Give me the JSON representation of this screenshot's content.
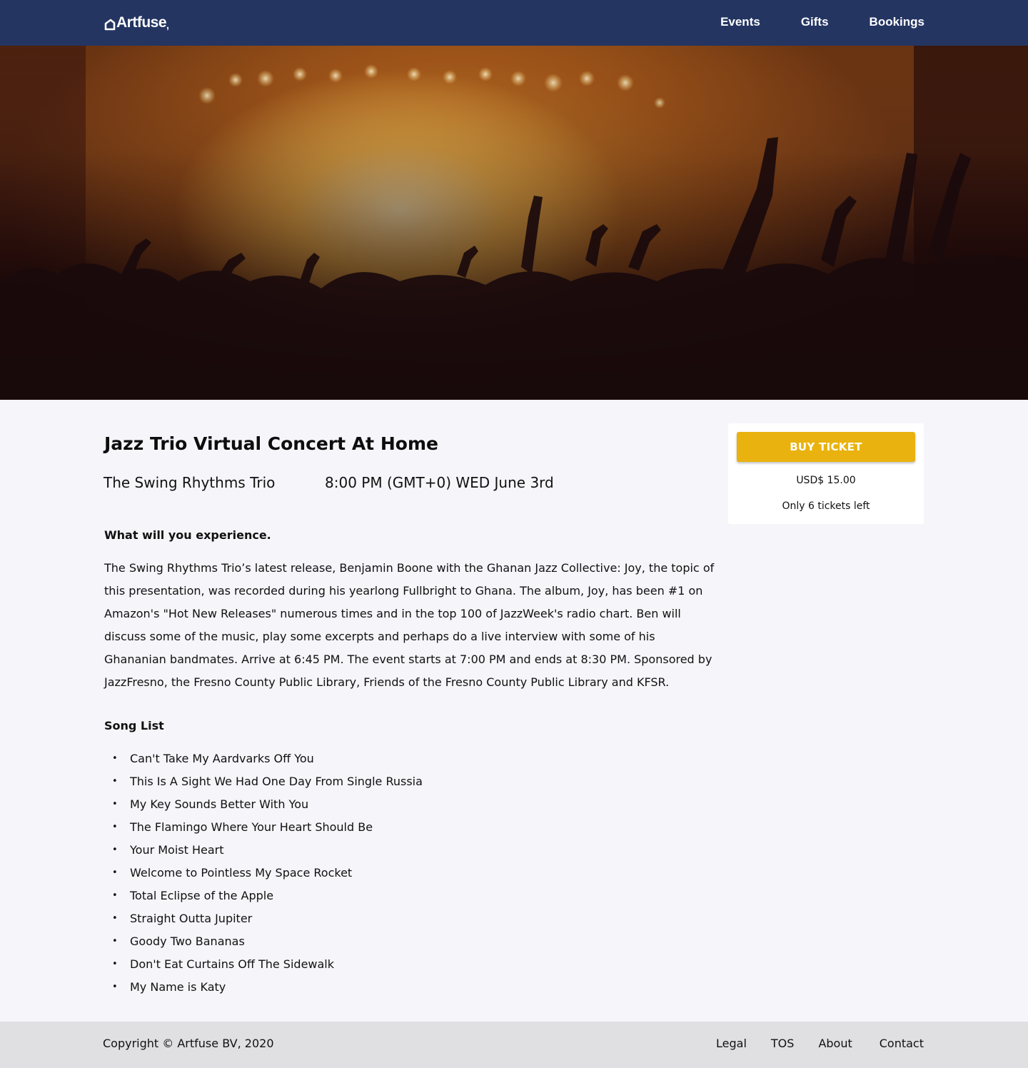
{
  "nav": {
    "logo_text": "Artfuse",
    "links": [
      "Events",
      "Gifts",
      "Bookings"
    ]
  },
  "event": {
    "title": "Jazz Trio Virtual Concert At Home",
    "performer": "The Swing Rhythms Trio",
    "datetime": "8:00 PM (GMT+0) WED June 3rd",
    "experience_heading": "What will you experience.",
    "description": "The Swing Rhythms Trio’s latest release, Benjamin Boone with the Ghanan Jazz Collective: Joy, the topic of this presentation, was recorded during his yearlong Fullbright to Ghana. The album, Joy, has been #1 on Amazon's \"Hot New Releases\" numerous times and in the top 100 of JazzWeek's radio chart. Ben will discuss some of the music, play some excerpts and perhaps do a live interview with some of his Ghananian bandmates. Arrive at 6:45 PM. The event starts at 7:00 PM and ends at 8:30 PM. Sponsored by JazzFresno, the Fresno County Public Library, Friends of the Fresno County Public Library and KFSR.",
    "song_list_heading": "Song List",
    "songs": [
      "Can't Take My Aardvarks Off You",
      "This Is A Sight We Had One Day From Single Russia",
      "My Key Sounds Better With You",
      "The Flamingo Where Your Heart Should Be",
      "Your Moist Heart",
      "Welcome to Pointless My Space Rocket",
      "Total Eclipse of the Apple",
      "Straight Outta Jupiter",
      "Goody Two Bananas",
      "Don't Eat Curtains Off The Sidewalk",
      "My Name is Katy"
    ]
  },
  "ticket": {
    "button_label": "BUY TICKET",
    "price": "USD$ 15.00",
    "availability": "Only 6 tickets left"
  },
  "footer": {
    "copyright": "Copyright © Artfuse BV, 2020",
    "links": [
      "Legal",
      "TOS",
      "About",
      "Contact"
    ]
  },
  "colors": {
    "nav_background": "#243562",
    "buy_button": "#e9b20f",
    "page_background": "#f5f5fa",
    "footer_background": "#e0dfe2"
  },
  "icons": {
    "logo": "artfuse-house-logo-icon",
    "hero": "concert-crowd-image"
  }
}
